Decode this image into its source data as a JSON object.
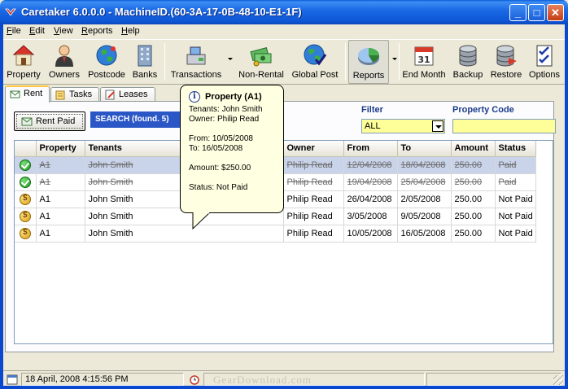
{
  "window": {
    "title": "Caretaker 6.0.0.0 - MachineID.(60-3A-17-0B-48-10-E1-1F)",
    "min_glyph": "_",
    "max_glyph": "□",
    "close_glyph": "✕"
  },
  "menu": {
    "items": [
      {
        "key": "F",
        "rest": "ile"
      },
      {
        "key": "E",
        "rest": "dit"
      },
      {
        "key": "V",
        "rest": "iew"
      },
      {
        "key": "R",
        "rest": "eports"
      },
      {
        "key": "H",
        "rest": "elp"
      }
    ]
  },
  "toolbar": {
    "buttons": [
      {
        "label": "Property",
        "icon": "house-icon"
      },
      {
        "label": "Owners",
        "icon": "person-icon"
      },
      {
        "label": "Postcode",
        "icon": "globe-icon"
      },
      {
        "label": "Banks",
        "icon": "building-icon"
      },
      {
        "label": "Transactions",
        "icon": "cash-register-icon"
      },
      {
        "label": "Non-Rental",
        "icon": "money-icon"
      },
      {
        "label": "Global Post",
        "icon": "globe-check-icon"
      },
      {
        "label": "Reports",
        "icon": "pie-chart-icon"
      },
      {
        "label": "End Month",
        "icon": "calendar-icon"
      },
      {
        "label": "Backup",
        "icon": "database-icon"
      },
      {
        "label": "Restore",
        "icon": "database-restore-icon"
      },
      {
        "label": "Options",
        "icon": "checklist-icon"
      }
    ]
  },
  "tabs": [
    {
      "label": "Rent",
      "active": true
    },
    {
      "label": "Tasks",
      "active": false
    },
    {
      "label": "Leases",
      "active": false
    }
  ],
  "actions": {
    "rent_paid": "Rent Paid",
    "search": "SEARCH (found. 5)"
  },
  "filter": {
    "label": "Filter",
    "value": "ALL"
  },
  "property_code": {
    "label": "Property Code",
    "value": ""
  },
  "table": {
    "columns": [
      "Property",
      "Tenants",
      "Owner",
      "From",
      "To",
      "Amount",
      "Status"
    ],
    "rows": [
      {
        "status_icon": "paid-check-icon",
        "property": "A1",
        "tenants": "John Smith",
        "owner": "Philip Read",
        "from": "12/04/2008",
        "to": "18/04/2008",
        "amount": "250.00",
        "status": "Paid"
      },
      {
        "status_icon": "paid-check-icon",
        "property": "A1",
        "tenants": "John Smith",
        "owner": "Philip Read",
        "from": "19/04/2008",
        "to": "25/04/2008",
        "amount": "250.00",
        "status": "Paid"
      },
      {
        "status_icon": "coin-icon",
        "property": "A1",
        "tenants": "John Smith",
        "owner": "Philip Read",
        "from": "26/04/2008",
        "to": "2/05/2008",
        "amount": "250.00",
        "status": "Not Paid"
      },
      {
        "status_icon": "coin-icon",
        "property": "A1",
        "tenants": "John Smith",
        "owner": "Philip Read",
        "from": "3/05/2008",
        "to": "9/05/2008",
        "amount": "250.00",
        "status": "Not Paid"
      },
      {
        "status_icon": "coin-icon",
        "property": "A1",
        "tenants": "John Smith",
        "owner": "Philip Read",
        "from": "10/05/2008",
        "to": "16/05/2008",
        "amount": "250.00",
        "status": "Not Paid"
      }
    ]
  },
  "tooltip": {
    "title": "Property (A1)",
    "tenants": "Tenants: John Smith",
    "owner": "Owner: Philip Read",
    "from": "From: 10/05/2008",
    "to": "To: 16/05/2008",
    "amount": "Amount: $250.00",
    "status": "Status: Not Paid"
  },
  "statusbar": {
    "datetime": "18 April, 2008   4:15:56 PM",
    "watermark": "GearDownload.com"
  }
}
